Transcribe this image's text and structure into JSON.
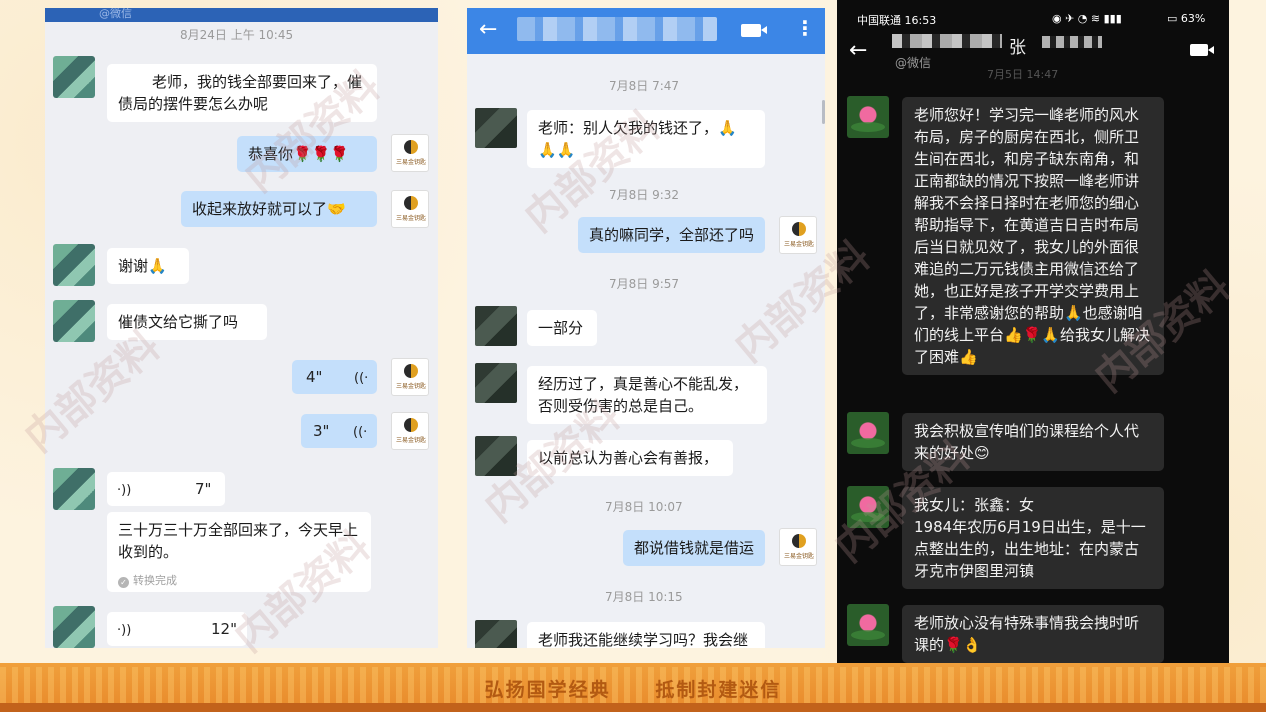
{
  "panel1": {
    "top_label": "@微信",
    "timestamp": "8月24日  上午 10:45",
    "msg1": "老师，我的钱全部要回来了，催债局的摆件要怎么办呢",
    "msg2": "恭喜你🌹🌹🌹",
    "msg3": "收起来放好就可以了🤝",
    "msg4": "谢谢🙏",
    "msg5": "催债文给它撕了吗",
    "voice1": "4\"",
    "voice2": "3\"",
    "voice3": "7\"",
    "msg6": "三十万三十万全部回来了，今天早上收到的。",
    "convert_done": "转换完成",
    "voice4": "12\""
  },
  "panel2": {
    "ts1": "7月8日  7:47",
    "msg1": "老师：别人欠我的钱还了，🙏🙏🙏",
    "ts2": "7月8日  9:32",
    "msg2": "真的嘛同学，全部还了吗",
    "ts3": "7月8日  9:57",
    "msg3": "一部分",
    "msg4": "经历过了，真是善心不能乱发，否则受伤害的总是自己。",
    "msg5": "以前总认为善心会有善报，",
    "ts4": "7月8日  10:07",
    "msg6": "都说借钱就是借运",
    "ts5": "7月8日  10:15",
    "msg7": "老师我还能继续学习吗？我会继"
  },
  "panel3": {
    "carrier": "中国联通 16:53",
    "battery": "63%",
    "title": "张",
    "sub": "@微信",
    "ts": "7月5日  14:47",
    "msg1": "老师您好！学习完一峰老师的风水布局，房子的厨房在西北，侧所卫生间在西北，和房子缺东南角，和正南都缺的情况下按照一峰老师讲解我不会择日择时在老师您的细心帮助指导下，在黄道吉日吉时布局后当日就见效了，我女儿的外面很难追的二万元钱债主用微信还给了她，也正好是孩子开学交学费用上了，非常感谢您的帮助🙏也感谢咱们的线上平台👍🌹🙏给我女儿解决了困难👍",
    "msg2": "我会积极宣传咱们的课程给个人代来的好处😊",
    "msg3": "我女儿：张鑫：女\n1984年农历6月19日出生，是十一点整出生的，出生地址：在内蒙古牙克市伊图里河镇",
    "msg4": "老师放心没有特殊事情我会拽时听课的🌹👌"
  },
  "banner": {
    "slogan_left": "弘扬国学经典",
    "slogan_right": "抵制封建迷信"
  },
  "watermark": "内部资料",
  "logo_caption": "三易金钥匙"
}
